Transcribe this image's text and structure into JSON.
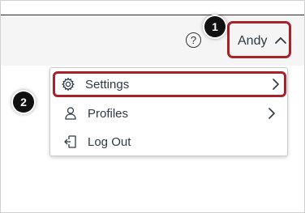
{
  "header": {
    "help_icon_glyph": "?",
    "user_name": "Andy"
  },
  "callouts": {
    "one": "1",
    "two": "2"
  },
  "menu": {
    "items": [
      {
        "label": "Settings",
        "icon": "gear-icon",
        "has_submenu": true,
        "highlighted": true
      },
      {
        "label": "Profiles",
        "icon": "person-icon",
        "has_submenu": true,
        "highlighted": false
      },
      {
        "label": "Log Out",
        "icon": "logout-icon",
        "has_submenu": false,
        "highlighted": false
      }
    ]
  },
  "colors": {
    "highlight": "#a5232b",
    "text": "#2d3b45",
    "header_bg": "#f5f5f5",
    "callout_bg": "#111111"
  }
}
